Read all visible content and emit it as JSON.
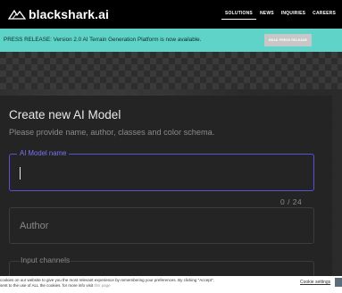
{
  "nav": {
    "logo_text": "blackshark",
    "logo_suffix": ".ai",
    "items": [
      {
        "label": "SOLUTIONS",
        "active": true
      },
      {
        "label": "NEWS",
        "active": false
      },
      {
        "label": "INQUIRIES",
        "active": false
      },
      {
        "label": "CAREERS",
        "active": false
      }
    ]
  },
  "banner": {
    "text": "PRESS RELEASE: Version 2.0 AI Terrain Generation Platform is now available.",
    "button_label": "READ PRESS RELEASE",
    "color": "#5fd3c8"
  },
  "form": {
    "title": "Create new AI Model",
    "subtitle": "Please provide name, author, classes and color schema.",
    "model_name_label": "AI Model name",
    "model_name_value": "",
    "model_name_counter": "0 / 24",
    "author_placeholder": "Author",
    "channels_label": "Input channels",
    "accent_color": "#5a52d6"
  },
  "cookie": {
    "line1": "cookies on our website to give you the most relevant experience by remembering your preferences. By clicking \"Accept\",",
    "line2": "sent to the use of ALL the cookies. for more info visit",
    "link_label": "this page",
    "settings_label": "Cookie settings"
  }
}
